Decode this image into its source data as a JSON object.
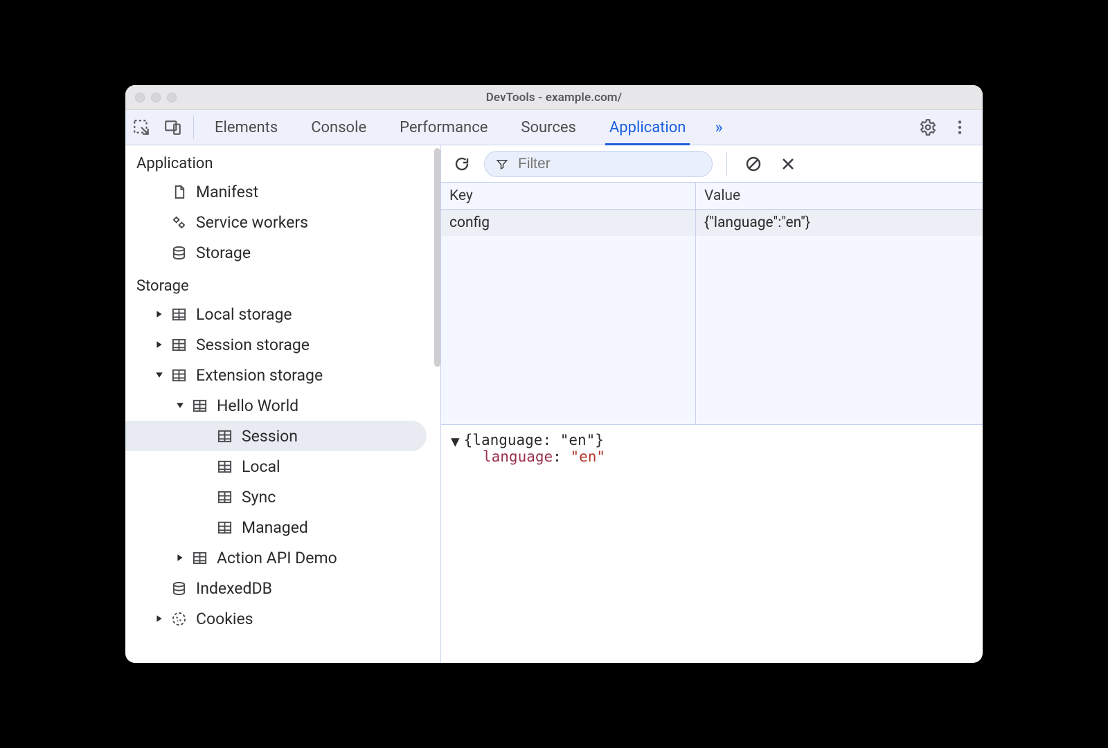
{
  "window": {
    "title": "DevTools - example.com/"
  },
  "tabs": {
    "items": [
      {
        "label": "Elements",
        "active": false
      },
      {
        "label": "Console",
        "active": false
      },
      {
        "label": "Performance",
        "active": false
      },
      {
        "label": "Sources",
        "active": false
      },
      {
        "label": "Application",
        "active": true
      }
    ],
    "more_symbol": "»"
  },
  "sidebar": {
    "groups": [
      {
        "title": "Application",
        "items": [
          {
            "label": "Manifest",
            "icon": "document-icon",
            "depth": 1
          },
          {
            "label": "Service workers",
            "icon": "gears-icon",
            "depth": 1
          },
          {
            "label": "Storage",
            "icon": "database-icon",
            "depth": 1
          }
        ]
      },
      {
        "title": "Storage",
        "items": [
          {
            "label": "Local storage",
            "icon": "table-icon",
            "depth": 1,
            "arrow": "right"
          },
          {
            "label": "Session storage",
            "icon": "table-icon",
            "depth": 1,
            "arrow": "right"
          },
          {
            "label": "Extension storage",
            "icon": "table-icon",
            "depth": 1,
            "arrow": "down"
          },
          {
            "label": "Hello World",
            "icon": "table-icon",
            "depth": 2,
            "arrow": "down"
          },
          {
            "label": "Session",
            "icon": "table-icon",
            "depth": 3,
            "selected": true
          },
          {
            "label": "Local",
            "icon": "table-icon",
            "depth": 3
          },
          {
            "label": "Sync",
            "icon": "table-icon",
            "depth": 3
          },
          {
            "label": "Managed",
            "icon": "table-icon",
            "depth": 3
          },
          {
            "label": "Action API Demo",
            "icon": "table-icon",
            "depth": 2,
            "arrow": "right"
          },
          {
            "label": "IndexedDB",
            "icon": "database-icon",
            "depth": 1
          },
          {
            "label": "Cookies",
            "icon": "cookie-icon",
            "depth": 1,
            "arrow": "right"
          }
        ]
      }
    ]
  },
  "toolbar": {
    "filter_placeholder": "Filter"
  },
  "table": {
    "headers": {
      "key": "Key",
      "value": "Value"
    },
    "rows": [
      {
        "key": "config",
        "value": "{\"language\":\"en\"}",
        "selected": true
      }
    ]
  },
  "preview": {
    "summary": "{language: \"en\"}",
    "prop_key": "language",
    "prop_val": "\"en\""
  }
}
